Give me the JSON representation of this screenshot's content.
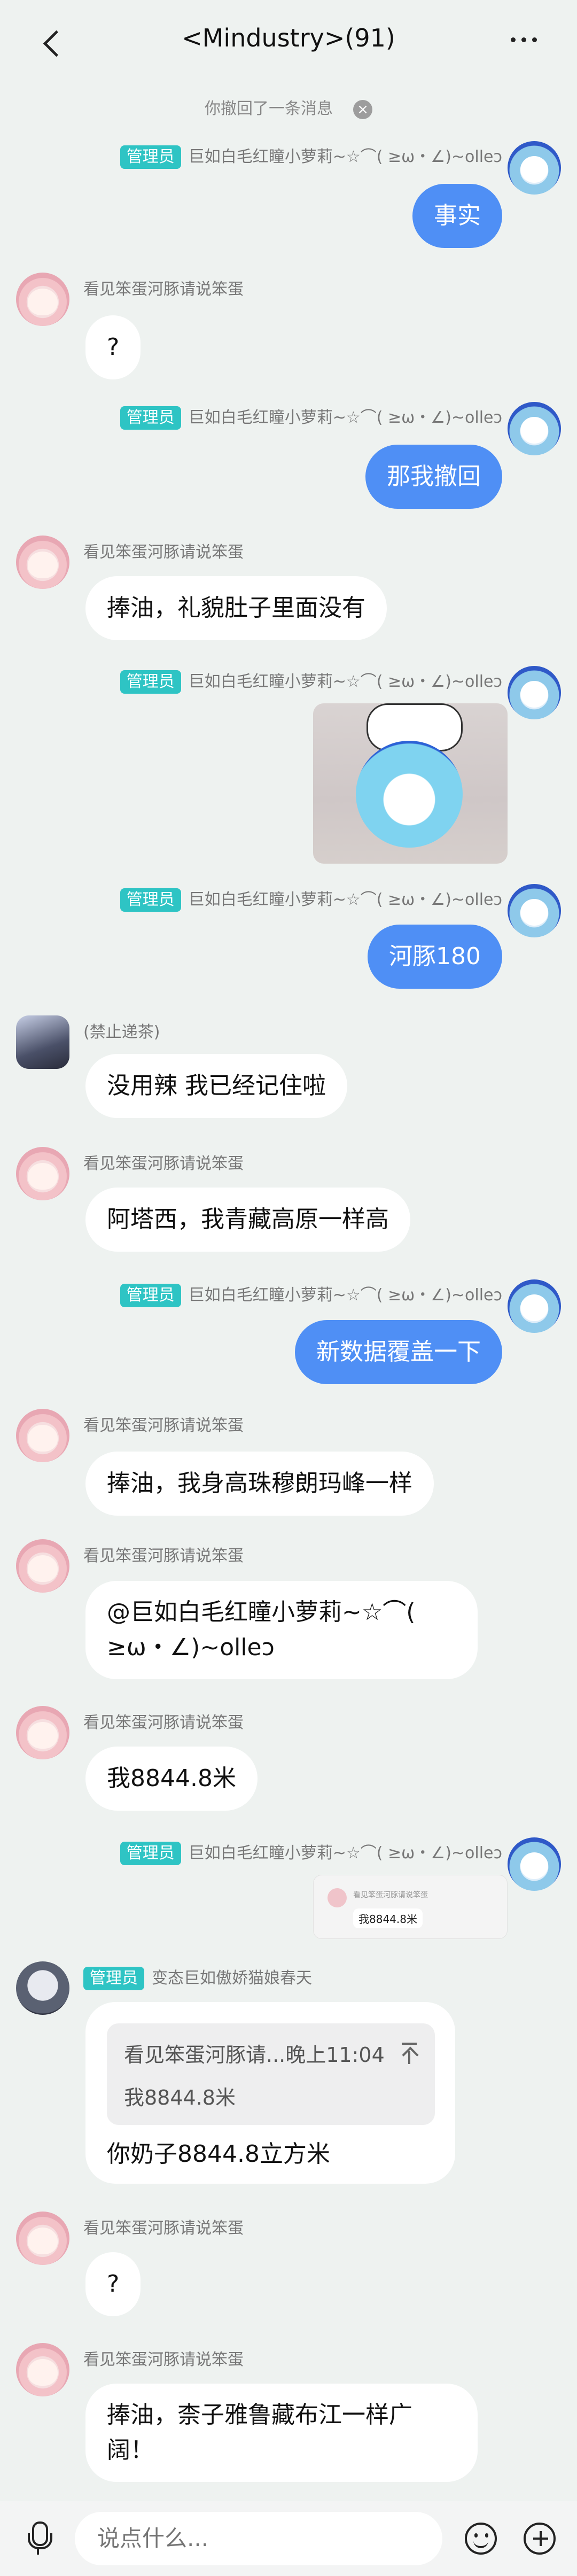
{
  "header": {
    "title": "<Mindustry>(91)"
  },
  "system_notice": "你撤回了一条消息",
  "users": {
    "admin_badge": "管理员",
    "me": "巨如白毛红瞳小萝莉~☆⌒( ≥ω・∠)~olleɔ",
    "pinkgirl": "看见笨蛋河豚请说笨蛋",
    "banned": "(禁止递茶)",
    "catgirl": "变态巨如傲娇猫娘春天"
  },
  "messages": {
    "m1": "事实",
    "m2": "?",
    "m3": "那我撤回",
    "m4": "捧油，礼貌肚子里面没有",
    "m6": "河豚180",
    "m7": "没用辣 我已经记住啦",
    "m8": "阿塔西，我青藏高原一样高",
    "m9": "新数据覆盖一下",
    "m10": "捧油，我身高珠穆朗玛峰一样",
    "m11": "@巨如白毛红瞳小萝莉~☆⌒( ≥ω・∠)~olleɔ",
    "m12": "我8844.8米",
    "m13_quote_name": "看见笨蛋河豚请说笨蛋",
    "m13_quote_text": "我8844.8米",
    "m14_reply_header": "看见笨蛋河豚请...晚上11:04",
    "m14_reply_quote": "我8844.8米",
    "m14_text": "你奶子8844.8立方米",
    "m15": "?",
    "m16": "捧油，柰子雅鲁藏布江一样广阔！"
  },
  "input": {
    "placeholder": "说点什么..."
  }
}
